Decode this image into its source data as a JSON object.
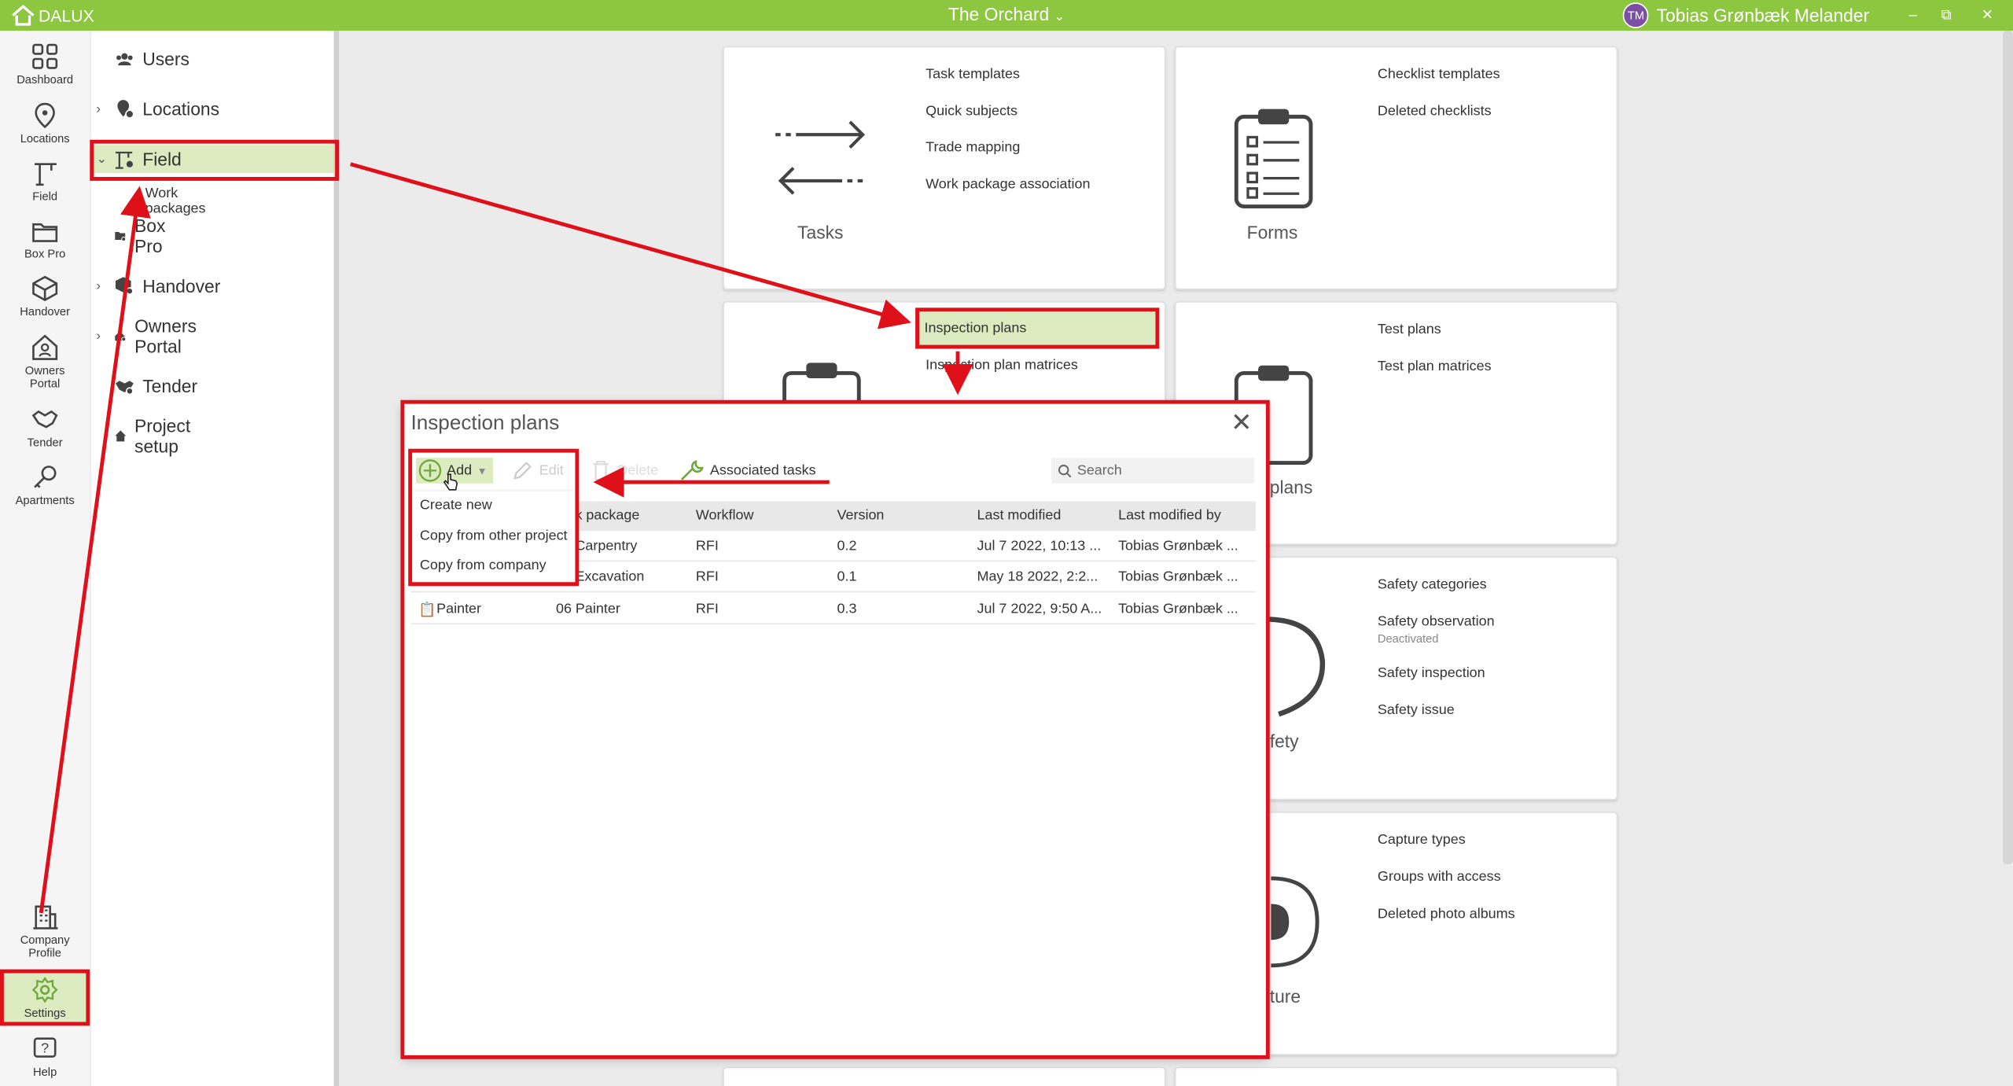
{
  "app": {
    "logo_text": "DALUX",
    "project": "The Orchard",
    "user_initials": "TM",
    "user_name": "Tobias Grønbæk Melander"
  },
  "colors": {
    "brand": "#8dc63f",
    "annotation": "#e0101a",
    "highlight": "#dcebc0",
    "avatar": "#7b4fa3"
  },
  "rail": {
    "dashboard": "Dashboard",
    "locations": "Locations",
    "field": "Field",
    "box_pro": "Box Pro",
    "handover": "Handover",
    "owners_portal_1": "Owners",
    "owners_portal_2": "Portal",
    "tender": "Tender",
    "apartments": "Apartments",
    "company_profile_1": "Company",
    "company_profile_2": "Profile",
    "settings": "Settings",
    "help": "Help"
  },
  "nav": {
    "users": "Users",
    "locations": "Locations",
    "field": "Field",
    "work_packages": "Work packages",
    "box_pro": "Box Pro",
    "handover": "Handover",
    "owners_portal": "Owners Portal",
    "tender": "Tender",
    "project_setup": "Project setup"
  },
  "tiles": {
    "tasks": {
      "title": "Tasks",
      "links": [
        "Task templates",
        "Quick subjects",
        "Trade mapping",
        "Work package association"
      ]
    },
    "forms": {
      "title": "Forms",
      "links": [
        "Checklist templates",
        "Deleted checklists"
      ]
    },
    "inspection": {
      "links": [
        "Inspection plans",
        "Inspection plan matrices"
      ]
    },
    "test": {
      "title_fragment": "plans",
      "links": [
        "Test plans",
        "Test plan matrices"
      ]
    },
    "safety": {
      "title_fragment": "fety",
      "links": [
        "Safety categories",
        "Safety observation",
        "Safety inspection",
        "Safety issue"
      ],
      "observation_status": "Deactivated"
    },
    "capture": {
      "title_fragment": "ture",
      "links": [
        "Capture types",
        "Groups with access",
        "Deleted photo albums"
      ]
    }
  },
  "modal": {
    "title": "Inspection plans",
    "toolbar": {
      "add": "Add",
      "edit": "Edit",
      "delete": "Delete",
      "associated_tasks": "Associated tasks"
    },
    "search_placeholder": "Search",
    "columns": [
      "k package",
      "Workflow",
      "Version",
      "Last modified",
      "Last modified by"
    ],
    "rows": [
      {
        "name": "",
        "package": "Carpentry",
        "workflow": "RFI",
        "version": "0.2",
        "modified": "Jul 7 2022, 10:13 ...",
        "by": "Tobias Grønbæk ..."
      },
      {
        "name": "",
        "package": "Excavation",
        "workflow": "RFI",
        "version": "0.1",
        "modified": "May 18 2022, 2:2...",
        "by": "Tobias Grønbæk ..."
      },
      {
        "name": "Painter",
        "package": "06 Painter",
        "workflow": "RFI",
        "version": "0.3",
        "modified": "Jul 7 2022, 9:50 A...",
        "by": "Tobias Grønbæk ..."
      }
    ],
    "add_menu": [
      "Create new",
      "Copy from other project",
      "Copy from company"
    ]
  }
}
